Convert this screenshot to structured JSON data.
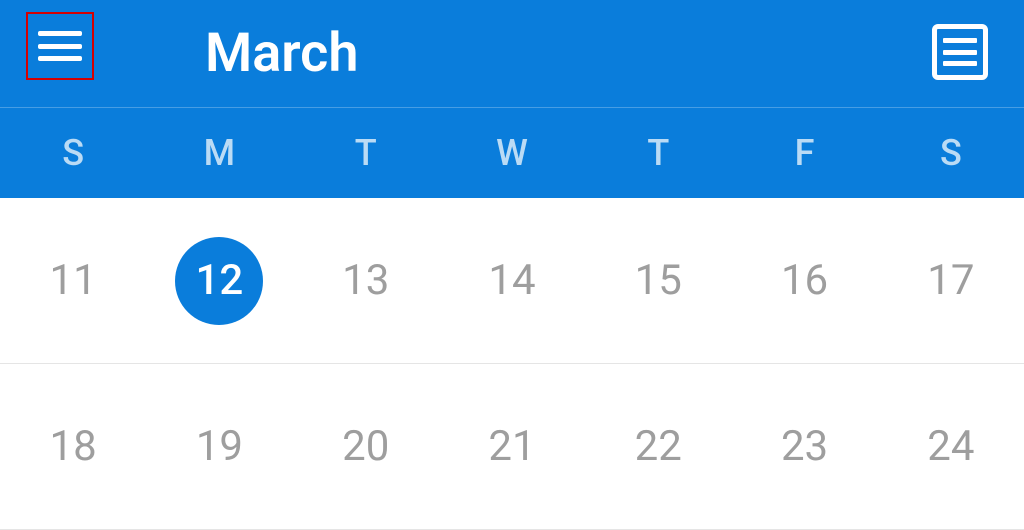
{
  "header": {
    "title": "March"
  },
  "weekdays": [
    "S",
    "M",
    "T",
    "W",
    "T",
    "F",
    "S"
  ],
  "weeks": [
    [
      {
        "day": "11",
        "selected": false
      },
      {
        "day": "12",
        "selected": true
      },
      {
        "day": "13",
        "selected": false
      },
      {
        "day": "14",
        "selected": false
      },
      {
        "day": "15",
        "selected": false
      },
      {
        "day": "16",
        "selected": false
      },
      {
        "day": "17",
        "selected": false
      }
    ],
    [
      {
        "day": "18",
        "selected": false
      },
      {
        "day": "19",
        "selected": false
      },
      {
        "day": "20",
        "selected": false
      },
      {
        "day": "21",
        "selected": false
      },
      {
        "day": "22",
        "selected": false
      },
      {
        "day": "23",
        "selected": false
      },
      {
        "day": "24",
        "selected": false
      }
    ]
  ],
  "colors": {
    "primary": "#0a7ddb",
    "highlight_border": "#d60000",
    "day_text": "#9e9e9e"
  }
}
